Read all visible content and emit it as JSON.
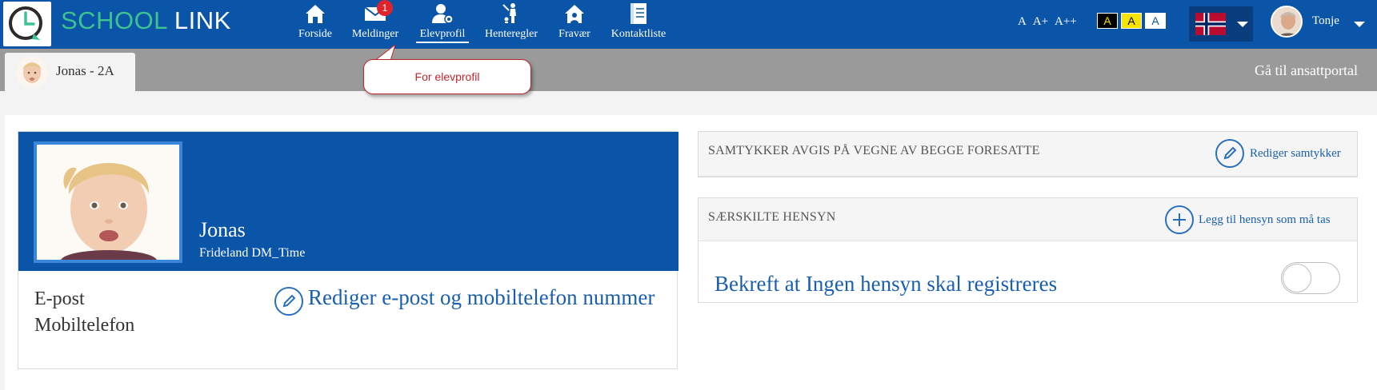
{
  "brand": {
    "school": "SCHOOL",
    "link": "LINK"
  },
  "nav": {
    "items": [
      {
        "id": "forside",
        "label": "Forside",
        "icon": "home-icon"
      },
      {
        "id": "meldinger",
        "label": "Meldinger",
        "icon": "mail-icon",
        "badge": "1"
      },
      {
        "id": "elevprofil",
        "label": "Elevprofil",
        "icon": "student-profile-icon",
        "active": true
      },
      {
        "id": "henteregler",
        "label": "Henteregler",
        "icon": "pickup-rules-icon"
      },
      {
        "id": "fravaer",
        "label": "Fravær",
        "icon": "absence-house-icon"
      },
      {
        "id": "kontaktliste",
        "label": "Kontaktliste",
        "icon": "contact-list-icon"
      }
    ]
  },
  "font_sizes": {
    "normal": "A",
    "large": "A+",
    "xlarge": "A++"
  },
  "contrast": {
    "black": "A",
    "yellow": "A",
    "white": "A"
  },
  "language": {
    "flag": "norway-flag-icon"
  },
  "user": {
    "name": "Tonje"
  },
  "subbar": {
    "child_tab": "Jonas - 2A",
    "employee_portal": "Gå til ansattportal"
  },
  "callout": {
    "text": "For elevprofil"
  },
  "profile": {
    "name": "Jonas",
    "school": "Frideland DM_Time",
    "email_label": "E-post",
    "phone_label": "Mobiltelefon",
    "edit_contact": "Rediger e-post og mobiltelefon nummer"
  },
  "consent": {
    "title": "SAMTYKKER AVGIS PÅ VEGNE AV BEGGE FORESATTE",
    "edit_label": "Rediger samtykker"
  },
  "considerations": {
    "title": "SÆRSKILTE HENSYN",
    "add_label": "Legg til hensyn som må tas",
    "confirm_text": "Bekreft at Ingen hensyn skal registreres"
  },
  "colors": {
    "primary": "#0b55a9",
    "brand_green": "#3ec28f",
    "badge": "#e0242c",
    "callout_red": "#c0272d",
    "link_blue": "#1a5fae",
    "subbar_gray": "#9a9a9a"
  }
}
